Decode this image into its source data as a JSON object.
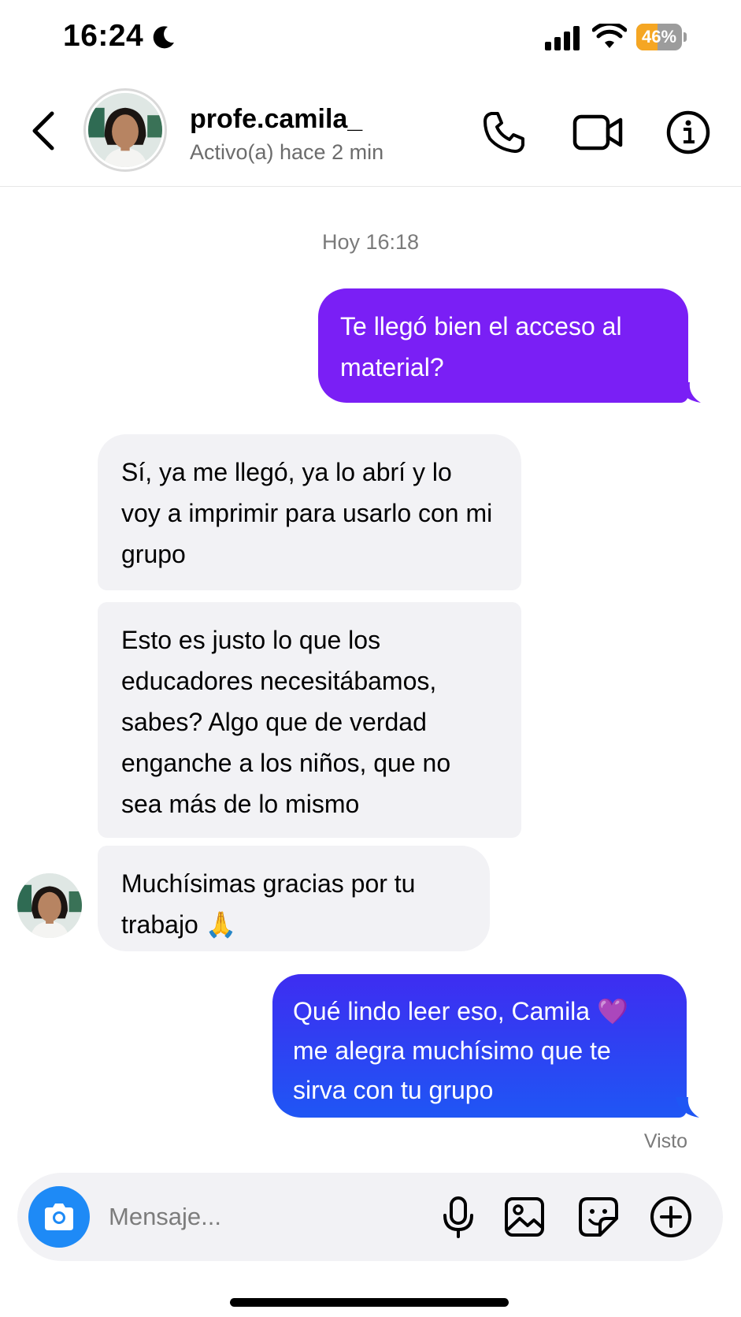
{
  "status_bar": {
    "time": "16:24",
    "battery_percent": "46%",
    "battery_level": 0.46
  },
  "header": {
    "username": "profe.camila_",
    "activity": "Activo(a) hace 2 min"
  },
  "conversation": {
    "timestamp": "Hoy 16:18",
    "messages": [
      {
        "direction": "outgoing",
        "text": "Te llegó bien el acceso al material?"
      },
      {
        "direction": "incoming",
        "text": "Sí, ya me llegó, ya lo abrí y lo voy a imprimir para usarlo con mi grupo"
      },
      {
        "direction": "incoming",
        "text": "Esto es justo lo que los educadores necesitábamos, sabes? Algo que de verdad enganche a los niños, que no sea más de lo mismo"
      },
      {
        "direction": "incoming",
        "text": "Muchísimas gracias por tu trabajo",
        "emoji": "🙏"
      },
      {
        "direction": "outgoing",
        "text": "Qué lindo leer eso, Camila",
        "emoji": "💜",
        "text_after": "me alegra muchísimo que te sirva con tu grupo"
      }
    ],
    "seen_label": "Visto"
  },
  "composer": {
    "placeholder": "Mensaje...",
    "value": ""
  },
  "colors": {
    "outgoing_purple": "#7a1ff5",
    "outgoing_blue_gradient": [
      "#3e2df1",
      "#1f56f4"
    ],
    "incoming_bubble": "#f2f2f5",
    "camera_button": "#1e8af6",
    "battery_fill": "#f5a623"
  },
  "icons": {
    "status": [
      "moon-icon",
      "signal-icon",
      "wifi-icon",
      "battery-icon"
    ],
    "header": [
      "back-icon",
      "phone-icon",
      "video-icon",
      "info-icon"
    ],
    "composer": [
      "camera-icon",
      "mic-icon",
      "gallery-icon",
      "sticker-icon",
      "plus-icon"
    ]
  }
}
